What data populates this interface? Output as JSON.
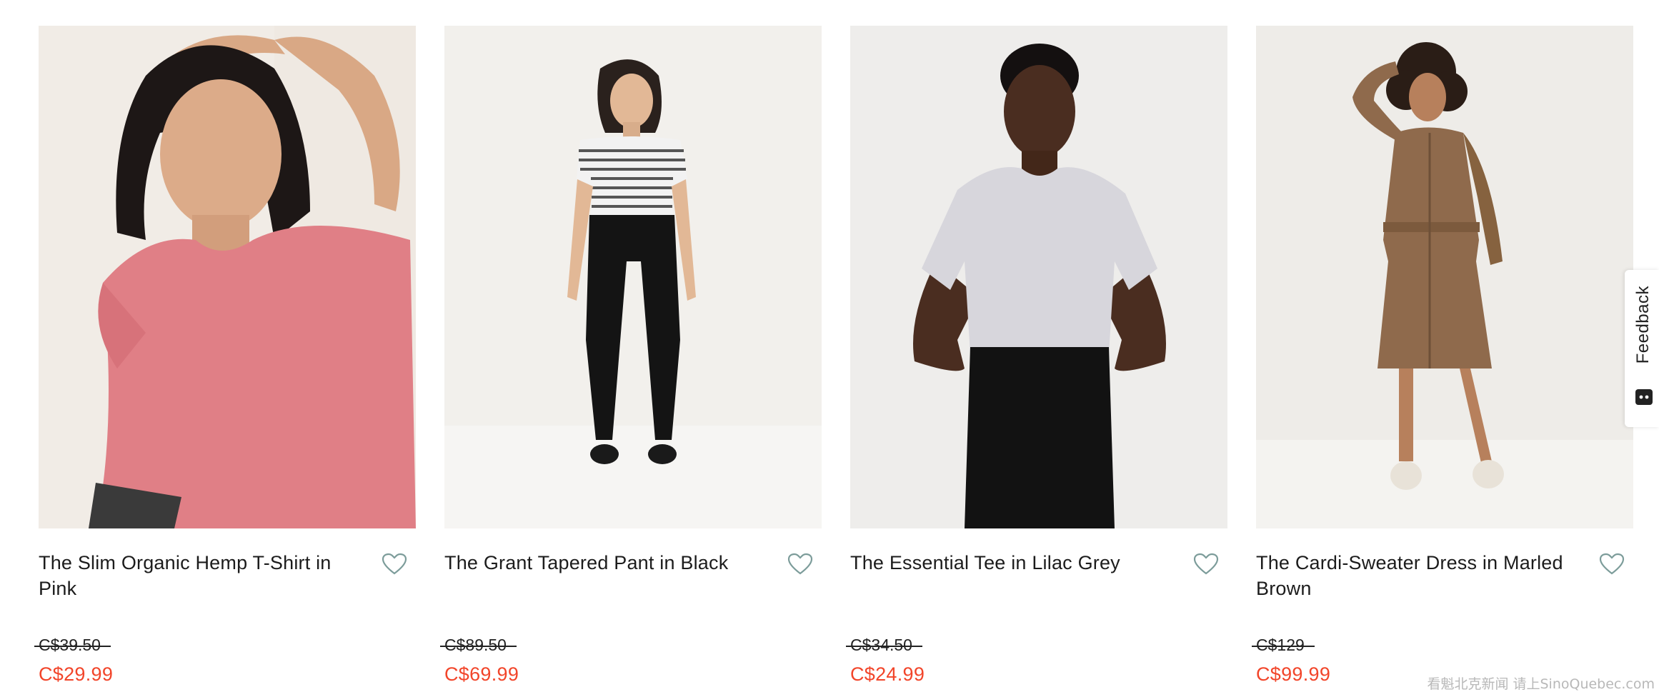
{
  "products": [
    {
      "name": "The Slim Organic Hemp T-Shirt in Pink",
      "original_price": "C$39.50",
      "sale_price": "C$29.99",
      "image": {
        "background": "#f1ece6",
        "top_color": "#e07f86",
        "bottom_color": "#3a3a3a",
        "skin": "#d9a885",
        "hair": "#1d1716"
      }
    },
    {
      "name": "The Grant Tapered Pant in Black",
      "original_price": "C$89.50",
      "sale_price": "C$69.99",
      "image": {
        "background": "#f2f0ec",
        "top_color": "#d7d7d7",
        "bottom_color": "#141414",
        "skin": "#e2b896",
        "hair": "#2a211d"
      }
    },
    {
      "name": "The Essential Tee in Lilac Grey",
      "original_price": "C$34.50",
      "sale_price": "C$24.99",
      "image": {
        "background": "#eeedeb",
        "top_color": "#d7d6dc",
        "bottom_color": "#121212",
        "skin": "#4a2d20",
        "hair": "#141010"
      }
    },
    {
      "name": "The Cardi-Sweater Dress in Marled Brown",
      "original_price": "C$129",
      "sale_price": "C$99.99",
      "image": {
        "background": "#eeece8",
        "top_color": "#8f6a4c",
        "bottom_color": "#8f6a4c",
        "skin": "#b7805c",
        "hair": "#2a1d16"
      }
    }
  ],
  "feedback": {
    "label": "Feedback"
  },
  "watermark": {
    "text": "看魁北克新闻 请上SinoQuebec.com"
  },
  "colors": {
    "sale": "#f2452a",
    "text": "#1c1c1c",
    "wishlist_icon": "#7c9c9a"
  }
}
